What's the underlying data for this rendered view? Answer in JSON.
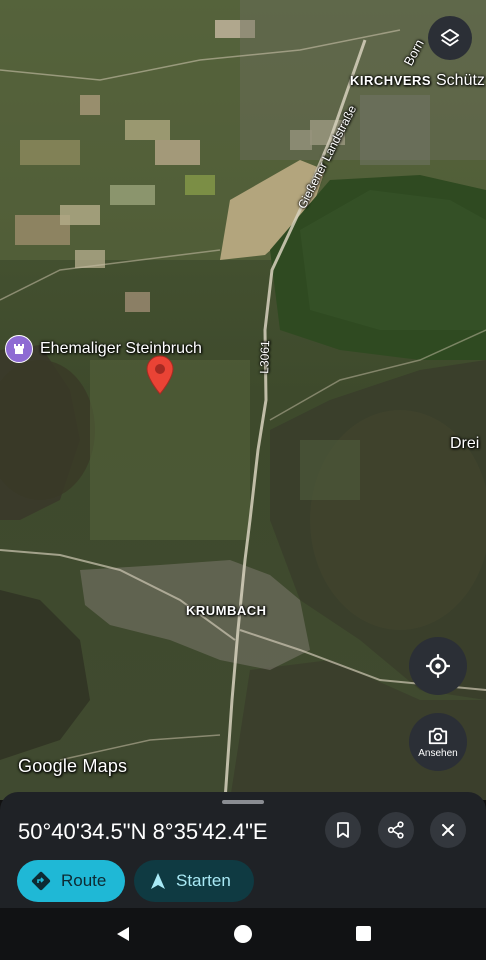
{
  "map": {
    "place_marker": {
      "icon": "castle-icon",
      "label": "Ehemaliger Steinbruch"
    },
    "labels": {
      "kirchvers": "KIRCHVERS",
      "schuetz": "Schütz",
      "born": "Born",
      "giessener": "Gießener Landstraße",
      "l3061": "L3061",
      "drei": "Drei",
      "krumbach": "KRUMBACH"
    },
    "attribution": "Google Maps",
    "controls": {
      "layers_icon": "layers-icon",
      "location_icon": "my-location-icon",
      "lens_icon": "camera-search-icon",
      "lens_label": "Ansehen"
    },
    "pin_color": "#ea4335"
  },
  "sheet": {
    "coordinates": "50°40'34.5\"N 8°35'42.4\"E",
    "save_icon": "bookmark-icon",
    "share_icon": "share-icon",
    "close_icon": "close-icon",
    "route_label": "Route",
    "start_label": "Starten",
    "accent": "#1fb8d6"
  },
  "nav": {
    "back_icon": "back-triangle-icon",
    "home_icon": "home-circle-icon",
    "recents_icon": "recents-square-icon"
  }
}
